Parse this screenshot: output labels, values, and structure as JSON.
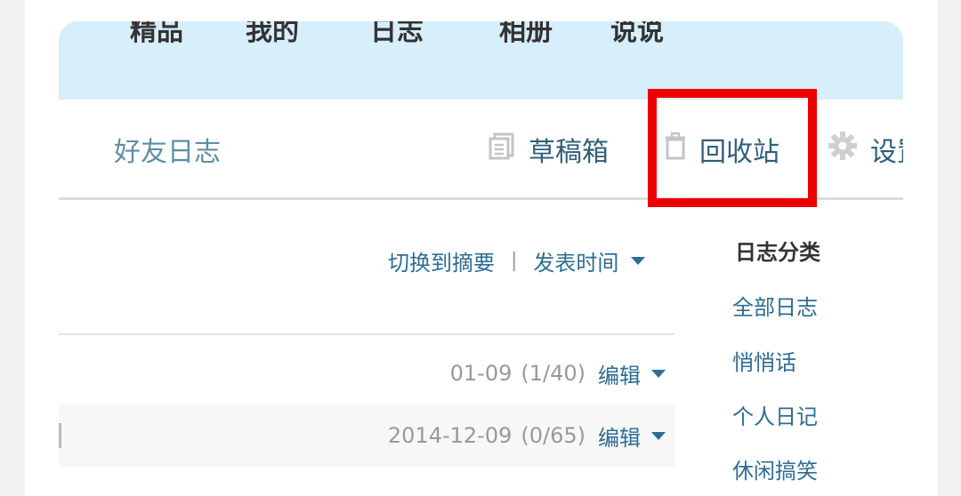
{
  "header": {
    "nav_items": [
      "精品",
      "我的",
      "日志",
      "相册",
      "说说"
    ]
  },
  "tabs": {
    "friends_diary": "好友日志",
    "drafts": "草稿箱",
    "recycle_bin": "回收站",
    "settings": "设置"
  },
  "toolbar": {
    "switch_view": "切换到摘要",
    "separator": "|",
    "sort_label": "发表时间"
  },
  "entries": [
    {
      "date": "01-09",
      "count": "(1/40)",
      "edit": "编辑"
    },
    {
      "date": "2014-12-09",
      "count": "(0/65)",
      "edit": "编辑"
    }
  ],
  "sidebar": {
    "title": "日志分类",
    "items": [
      "全部日志",
      "悄悄话",
      "个人日记",
      "休闲搞笑"
    ]
  },
  "colors": {
    "accent": "#2d6d94",
    "highlight": "#ef0000",
    "banner": "#d7eefb"
  }
}
